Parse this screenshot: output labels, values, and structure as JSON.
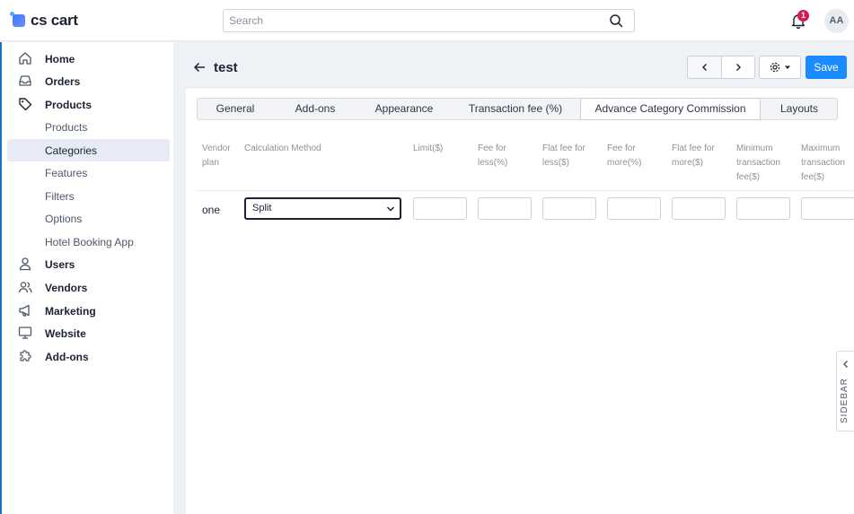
{
  "header": {
    "logo_text": "cs cart",
    "search_placeholder": "Search",
    "notification_count": "1",
    "avatar_initials": "AA"
  },
  "sidebar": {
    "items": [
      {
        "label": "Home",
        "icon": "home-icon"
      },
      {
        "label": "Orders",
        "icon": "inbox-icon"
      },
      {
        "label": "Products",
        "icon": "tag-icon"
      },
      {
        "label": "Products"
      },
      {
        "label": "Categories",
        "active": true
      },
      {
        "label": "Features"
      },
      {
        "label": "Filters"
      },
      {
        "label": "Options"
      },
      {
        "label": "Hotel Booking App"
      },
      {
        "label": "Users",
        "icon": "user-icon"
      },
      {
        "label": "Vendors",
        "icon": "users-icon"
      },
      {
        "label": "Marketing",
        "icon": "megaphone-icon"
      },
      {
        "label": "Website",
        "icon": "monitor-icon"
      },
      {
        "label": "Add-ons",
        "icon": "puzzle-icon"
      }
    ]
  },
  "page": {
    "title": "test",
    "save_label": "Save"
  },
  "tabs": [
    {
      "label": "General"
    },
    {
      "label": "Add-ons"
    },
    {
      "label": "Appearance"
    },
    {
      "label": "Transaction fee (%)"
    },
    {
      "label": "Advance Category Commission",
      "active": true
    },
    {
      "label": "Layouts"
    }
  ],
  "table": {
    "headers": {
      "vendor_plan": [
        "Vendor",
        "plan"
      ],
      "calculation_method": [
        "Calculation Method"
      ],
      "limit": [
        "Limit($)"
      ],
      "fee_less": [
        "Fee for",
        "less(%)"
      ],
      "flat_less": [
        "Flat fee for",
        "less($)"
      ],
      "fee_more": [
        "Fee for",
        "more(%)"
      ],
      "flat_more": [
        "Flat fee for",
        "more($)"
      ],
      "min_fee": [
        "Minimum",
        "transaction",
        "fee($)"
      ],
      "max_fee": [
        "Maximum",
        "transaction",
        "fee($)"
      ]
    },
    "rows": [
      {
        "vendor_plan": "one",
        "calculation_method": "Split"
      }
    ]
  },
  "right_sidebar_label": "SIDEBAR"
}
